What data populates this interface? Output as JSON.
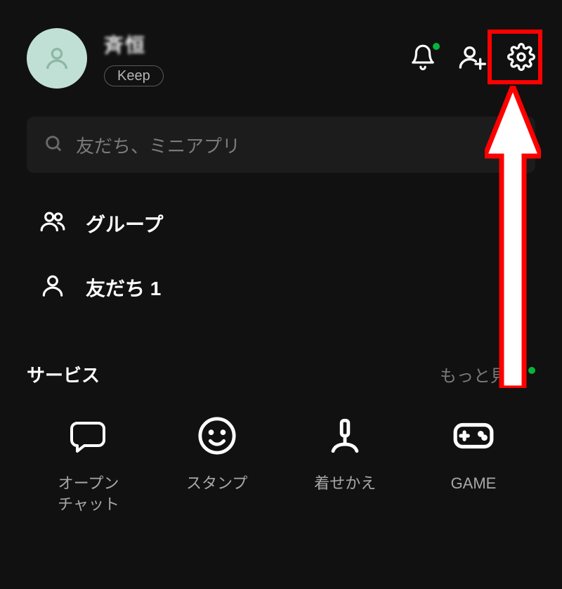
{
  "header": {
    "username": "斉恒",
    "keep_label": "Keep",
    "colors": {
      "accent_green": "#07b53b",
      "highlight_red": "#ff0000"
    }
  },
  "search": {
    "placeholder": "友だち、ミニアプリ"
  },
  "list": {
    "items": [
      {
        "icon": "group-icon",
        "label": "グループ"
      },
      {
        "icon": "friend-icon",
        "label": "友だち 1"
      }
    ]
  },
  "services": {
    "title": "サービス",
    "more_label": "もっと見る",
    "items": [
      {
        "icon": "openchat-icon",
        "label": "オープン\nチャット"
      },
      {
        "icon": "stamp-icon",
        "label": "スタンプ"
      },
      {
        "icon": "theme-icon",
        "label": "着せかえ"
      },
      {
        "icon": "game-icon",
        "label": "GAME"
      }
    ]
  }
}
